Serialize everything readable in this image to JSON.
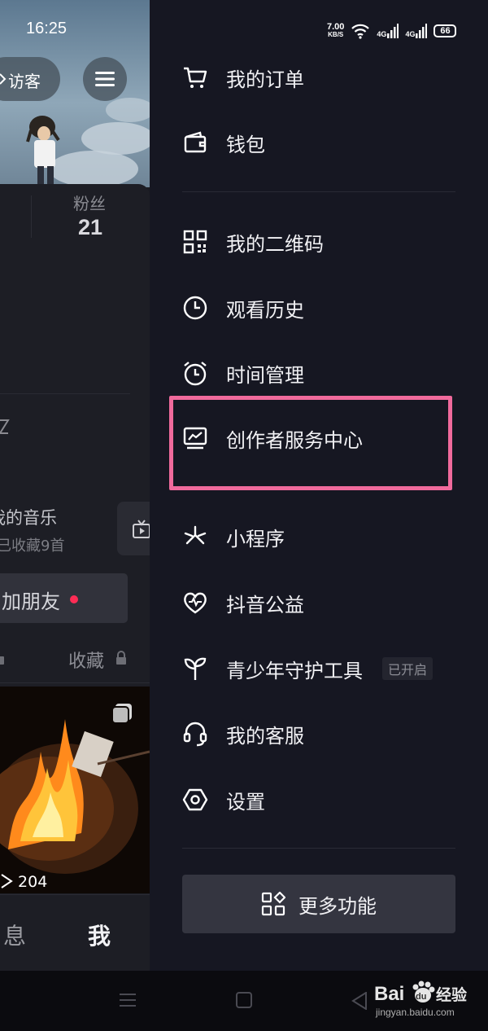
{
  "status_bar": {
    "time": "16:25",
    "net_speed": "7.00",
    "net_unit": "KB/S",
    "signal_1": "4G",
    "signal_2": "4G",
    "battery": "66"
  },
  "profile_background": {
    "visitor_label": "访客",
    "fans_label": "粉丝",
    "fans_count": "21",
    "music_title": "我的音乐",
    "music_subtitle": "已收藏9首",
    "add_friend_label": "加朋友",
    "collect_tab_label": "收藏",
    "video_play_count": "204",
    "bottom_tabs": [
      "息",
      "我"
    ]
  },
  "drawer": {
    "items": [
      {
        "id": "orders",
        "label": "我的订单",
        "icon": "cart-icon"
      },
      {
        "id": "wallet",
        "label": "钱包",
        "icon": "wallet-icon"
      },
      {
        "id": "qrcode",
        "label": "我的二维码",
        "icon": "qrcode-icon"
      },
      {
        "id": "history",
        "label": "观看历史",
        "icon": "clock-icon"
      },
      {
        "id": "time",
        "label": "时间管理",
        "icon": "alarm-icon"
      },
      {
        "id": "creator",
        "label": "创作者服务中心",
        "icon": "chart-monitor-icon"
      },
      {
        "id": "miniapp",
        "label": "小程序",
        "icon": "asterisk-icon"
      },
      {
        "id": "charity",
        "label": "抖音公益",
        "icon": "heart-icon"
      },
      {
        "id": "youth",
        "label": "青少年守护工具",
        "icon": "sprout-icon",
        "badge": "已开启"
      },
      {
        "id": "service",
        "label": "我的客服",
        "icon": "headset-icon"
      },
      {
        "id": "settings",
        "label": "设置",
        "icon": "hexagon-settings-icon"
      }
    ],
    "more_button": "更多功能",
    "highlight_color": "#f06a9c"
  },
  "watermark": {
    "url": "jingyan.baidu.com"
  }
}
